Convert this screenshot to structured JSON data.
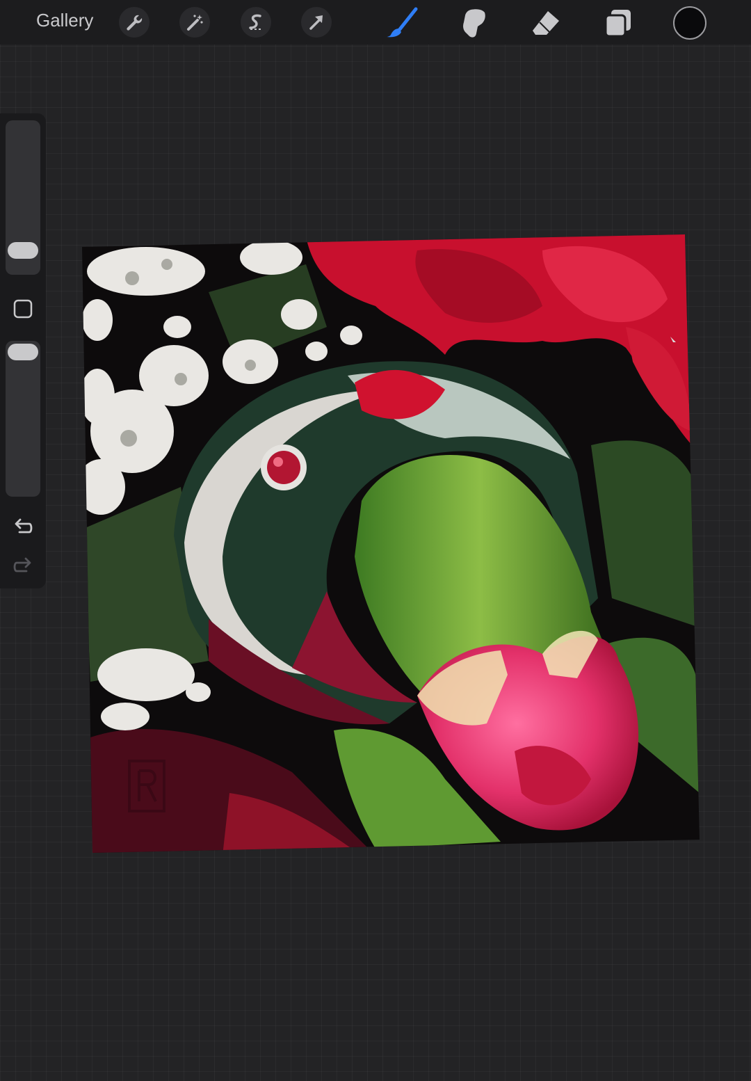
{
  "toolbar": {
    "gallery_label": "Gallery",
    "actions": [
      {
        "name": "actions",
        "icon": "wrench-icon"
      },
      {
        "name": "adjustments",
        "icon": "magic-wand-icon"
      },
      {
        "name": "selection",
        "icon": "selection-s-icon"
      },
      {
        "name": "transform",
        "icon": "arrow-cursor-icon"
      }
    ],
    "tools": [
      {
        "name": "brush",
        "icon": "brush-icon",
        "active": true
      },
      {
        "name": "smudge",
        "icon": "smudge-icon",
        "active": false
      },
      {
        "name": "eraser",
        "icon": "eraser-icon",
        "active": false
      },
      {
        "name": "layers",
        "icon": "layers-icon",
        "active": false
      }
    ],
    "active_tool_color": "#2f7ef6",
    "current_color": "#0a0a0c"
  },
  "sidebar": {
    "brush_size_level": 0.18,
    "opacity_level": 0.9,
    "modify_button_icon": "square-icon",
    "undo_icon": "undo-icon",
    "redo_icon": "redo-icon"
  },
  "canvas": {
    "signature_mark": "R"
  }
}
